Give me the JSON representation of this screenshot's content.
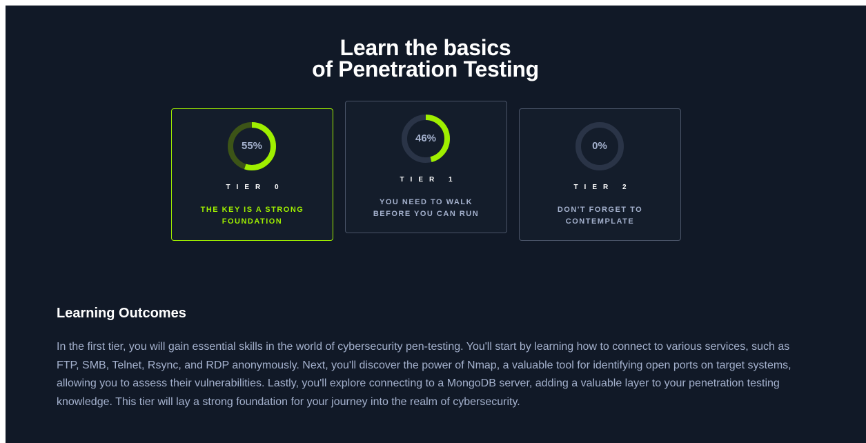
{
  "hero": {
    "title_line1": "Learn the basics",
    "title_line2": "of Penetration Testing"
  },
  "tiers": [
    {
      "progress_label": "55%",
      "progress_value": 55,
      "name": "TIER 0",
      "description": "THE KEY IS A STRONG FOUNDATION",
      "active": true
    },
    {
      "progress_label": "46%",
      "progress_value": 46,
      "name": "TIER 1",
      "description": "YOU NEED TO WALK BEFORE YOU CAN RUN",
      "active": false
    },
    {
      "progress_label": "0%",
      "progress_value": 0,
      "name": "TIER 2",
      "description": "DON'T FORGET TO CONTEMPLATE",
      "active": false
    }
  ],
  "outcomes": {
    "heading": "Learning Outcomes",
    "body": "In the first tier, you will gain essential skills in the world of cybersecurity pen-testing. You'll start by learning how to connect to various services, such as FTP, SMB, Telnet, Rsync, and RDP anonymously. Next, you'll discover the power of Nmap, a valuable tool for identifying open ports on target systems, allowing you to assess their vulnerabilities. Lastly, you'll explore connecting to a MongoDB server, adding a valuable layer to your penetration testing knowledge. This tier will lay a strong foundation for your journey into the realm of cybersecurity."
  },
  "colors": {
    "background": "#111927",
    "card_background": "#141d2b",
    "accent": "#9fef00",
    "muted_text": "#a4b1cd",
    "card_border": "#4a5468",
    "ring_track": "#2a3447",
    "ring_track_active": "#3c5417"
  }
}
